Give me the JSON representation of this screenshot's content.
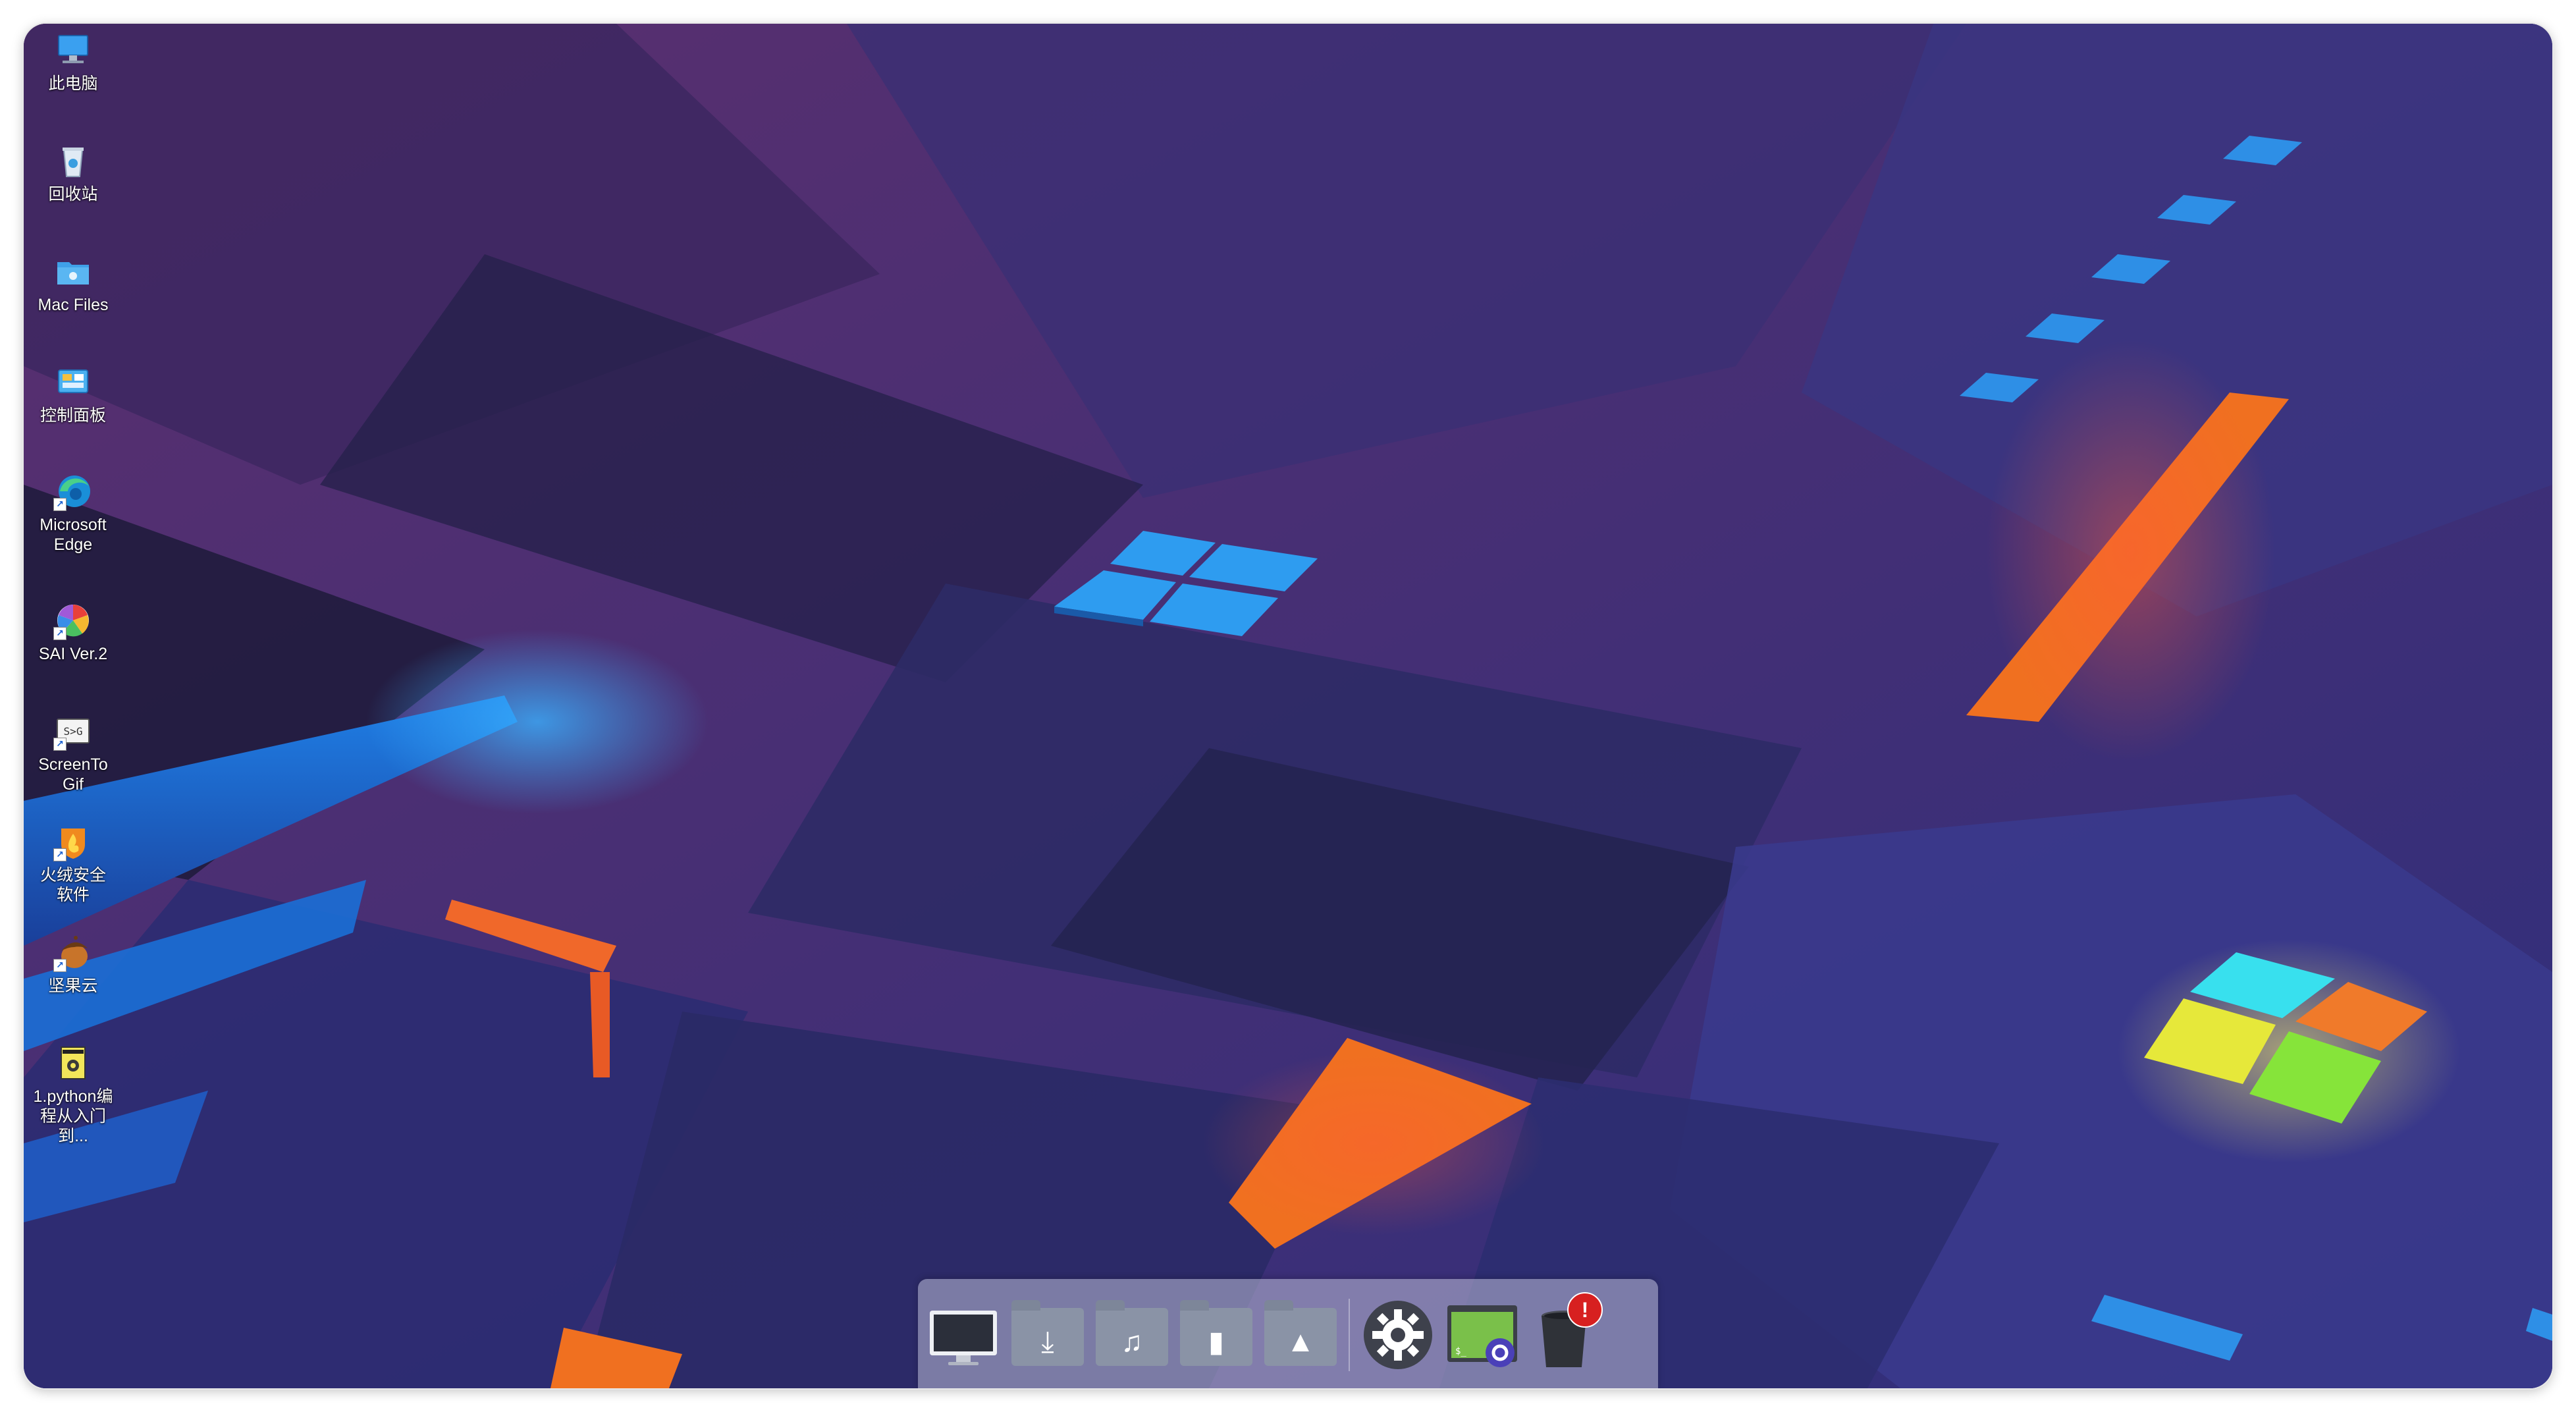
{
  "desktop": {
    "icons": [
      {
        "label": "此电脑",
        "icon": "this-pc-icon"
      },
      {
        "label": "回收站",
        "icon": "recycle-bin-icon"
      },
      {
        "label": "Mac Files",
        "icon": "mac-files-folder-icon"
      },
      {
        "label": "控制面板",
        "icon": "control-panel-icon"
      },
      {
        "label": "Microsoft Edge",
        "icon": "edge-icon"
      },
      {
        "label": "SAI Ver.2",
        "icon": "sai-icon"
      },
      {
        "label": "ScreenToGif",
        "icon": "screentogif-icon"
      },
      {
        "label": "火绒安全软件",
        "icon": "huorong-icon"
      },
      {
        "label": "坚果云",
        "icon": "jianguoyun-icon"
      },
      {
        "label": "1.python编程从入门到...",
        "icon": "python-book-icon"
      }
    ]
  },
  "dock": {
    "items": [
      {
        "name": "computer",
        "icon": "monitor-icon"
      },
      {
        "name": "downloads",
        "icon": "downloads-folder-icon"
      },
      {
        "name": "music",
        "icon": "music-folder-icon"
      },
      {
        "name": "documents",
        "icon": "documents-folder-icon"
      },
      {
        "name": "pictures",
        "icon": "pictures-folder-icon"
      },
      {
        "name": "settings",
        "icon": "gear-icon"
      },
      {
        "name": "terminal-settings",
        "icon": "terminal-gear-icon"
      },
      {
        "name": "trash",
        "icon": "trash-icon"
      }
    ],
    "trash_badge": "!"
  },
  "colors": {
    "accent_blue": "#2e8fe6",
    "accent_orange": "#f07020",
    "logo_cyan": "#38e0ee",
    "logo_orange": "#f07a2a",
    "logo_yellow": "#e6e83a",
    "logo_green": "#86e43a"
  }
}
